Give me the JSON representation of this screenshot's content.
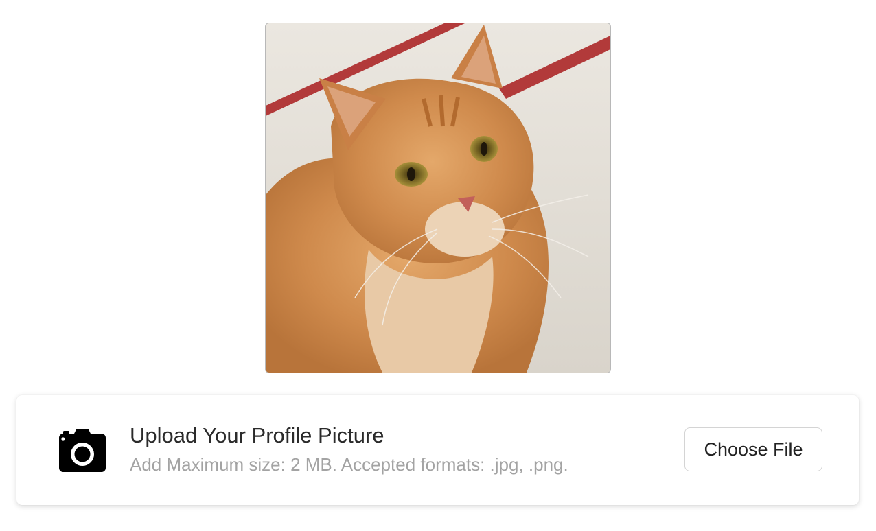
{
  "profile_preview": {
    "alt": "Orange tabby cat"
  },
  "upload": {
    "icon": "camera-icon",
    "title": "Upload Your Profile Picture",
    "subtitle": "Add Maximum size: 2 MB. Accepted formats: .jpg, .png.",
    "button_label": "Choose File"
  },
  "colors": {
    "title_text": "#2b2b2b",
    "subtitle_text": "#a3a3a3",
    "button_border": "#d4d4d4"
  }
}
